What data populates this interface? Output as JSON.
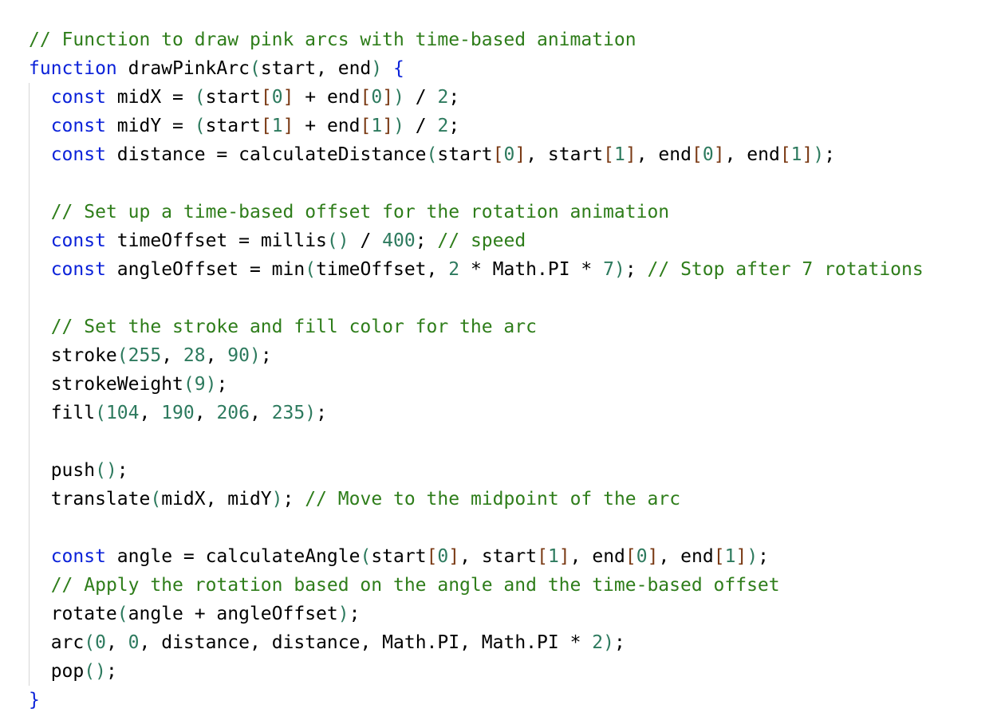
{
  "code": {
    "language": "javascript",
    "colors": {
      "keyword": "#0b22d9",
      "comment": "#2e7d1a",
      "number": "#2d7a5e",
      "square_bracket": "#7a3a14",
      "background": "#ffffff"
    },
    "lines": [
      {
        "tokens": [
          {
            "t": "// Function to draw pink arcs with time-based animation",
            "c": "cm"
          }
        ]
      },
      {
        "tokens": [
          {
            "t": "function",
            "c": "kw"
          },
          {
            "t": " drawPinkArc"
          },
          {
            "t": "(",
            "c": "pb"
          },
          {
            "t": "start, end"
          },
          {
            "t": ")",
            "c": "pb"
          },
          {
            "t": " "
          },
          {
            "t": "{",
            "c": "cb"
          }
        ]
      },
      {
        "tokens": [
          {
            "t": "  "
          },
          {
            "t": "const",
            "c": "kw"
          },
          {
            "t": " midX = "
          },
          {
            "t": "(",
            "c": "pb"
          },
          {
            "t": "start"
          },
          {
            "t": "[",
            "c": "br"
          },
          {
            "t": "0",
            "c": "num"
          },
          {
            "t": "]",
            "c": "br"
          },
          {
            "t": " + end"
          },
          {
            "t": "[",
            "c": "br"
          },
          {
            "t": "0",
            "c": "num"
          },
          {
            "t": "]",
            "c": "br"
          },
          {
            "t": ")",
            "c": "pb"
          },
          {
            "t": " / "
          },
          {
            "t": "2",
            "c": "num"
          },
          {
            "t": ";"
          }
        ]
      },
      {
        "tokens": [
          {
            "t": "  "
          },
          {
            "t": "const",
            "c": "kw"
          },
          {
            "t": " midY = "
          },
          {
            "t": "(",
            "c": "pb"
          },
          {
            "t": "start"
          },
          {
            "t": "[",
            "c": "br"
          },
          {
            "t": "1",
            "c": "num"
          },
          {
            "t": "]",
            "c": "br"
          },
          {
            "t": " + end"
          },
          {
            "t": "[",
            "c": "br"
          },
          {
            "t": "1",
            "c": "num"
          },
          {
            "t": "]",
            "c": "br"
          },
          {
            "t": ")",
            "c": "pb"
          },
          {
            "t": " / "
          },
          {
            "t": "2",
            "c": "num"
          },
          {
            "t": ";"
          }
        ]
      },
      {
        "tokens": [
          {
            "t": "  "
          },
          {
            "t": "const",
            "c": "kw"
          },
          {
            "t": " distance = calculateDistance"
          },
          {
            "t": "(",
            "c": "pb"
          },
          {
            "t": "start"
          },
          {
            "t": "[",
            "c": "br"
          },
          {
            "t": "0",
            "c": "num"
          },
          {
            "t": "]",
            "c": "br"
          },
          {
            "t": ", start"
          },
          {
            "t": "[",
            "c": "br"
          },
          {
            "t": "1",
            "c": "num"
          },
          {
            "t": "]",
            "c": "br"
          },
          {
            "t": ", end"
          },
          {
            "t": "[",
            "c": "br"
          },
          {
            "t": "0",
            "c": "num"
          },
          {
            "t": "]",
            "c": "br"
          },
          {
            "t": ", end"
          },
          {
            "t": "[",
            "c": "br"
          },
          {
            "t": "1",
            "c": "num"
          },
          {
            "t": "]",
            "c": "br"
          },
          {
            "t": ")",
            "c": "pb"
          },
          {
            "t": ";"
          }
        ]
      },
      {
        "tokens": []
      },
      {
        "tokens": [
          {
            "t": "  "
          },
          {
            "t": "// Set up a time-based offset for the rotation animation",
            "c": "cm"
          }
        ]
      },
      {
        "tokens": [
          {
            "t": "  "
          },
          {
            "t": "const",
            "c": "kw"
          },
          {
            "t": " timeOffset = millis"
          },
          {
            "t": "()",
            "c": "pb"
          },
          {
            "t": " / "
          },
          {
            "t": "400",
            "c": "num"
          },
          {
            "t": "; "
          },
          {
            "t": "// speed",
            "c": "cm"
          }
        ]
      },
      {
        "tokens": [
          {
            "t": "  "
          },
          {
            "t": "const",
            "c": "kw"
          },
          {
            "t": " angleOffset = min"
          },
          {
            "t": "(",
            "c": "pb"
          },
          {
            "t": "timeOffset, "
          },
          {
            "t": "2",
            "c": "num"
          },
          {
            "t": " * Math.PI * "
          },
          {
            "t": "7",
            "c": "num"
          },
          {
            "t": ")",
            "c": "pb"
          },
          {
            "t": "; "
          },
          {
            "t": "// Stop after 7 rotations",
            "c": "cm"
          }
        ]
      },
      {
        "tokens": []
      },
      {
        "tokens": [
          {
            "t": "  "
          },
          {
            "t": "// Set the stroke and fill color for the arc",
            "c": "cm"
          }
        ]
      },
      {
        "tokens": [
          {
            "t": "  stroke"
          },
          {
            "t": "(",
            "c": "pb"
          },
          {
            "t": "255",
            "c": "num"
          },
          {
            "t": ", "
          },
          {
            "t": "28",
            "c": "num"
          },
          {
            "t": ", "
          },
          {
            "t": "90",
            "c": "num"
          },
          {
            "t": ")",
            "c": "pb"
          },
          {
            "t": ";"
          }
        ]
      },
      {
        "tokens": [
          {
            "t": "  strokeWeight"
          },
          {
            "t": "(",
            "c": "pb"
          },
          {
            "t": "9",
            "c": "num"
          },
          {
            "t": ")",
            "c": "pb"
          },
          {
            "t": ";"
          }
        ]
      },
      {
        "tokens": [
          {
            "t": "  fill"
          },
          {
            "t": "(",
            "c": "pb"
          },
          {
            "t": "104",
            "c": "num"
          },
          {
            "t": ", "
          },
          {
            "t": "190",
            "c": "num"
          },
          {
            "t": ", "
          },
          {
            "t": "206",
            "c": "num"
          },
          {
            "t": ", "
          },
          {
            "t": "235",
            "c": "num"
          },
          {
            "t": ")",
            "c": "pb"
          },
          {
            "t": ";"
          }
        ]
      },
      {
        "tokens": []
      },
      {
        "tokens": [
          {
            "t": "  push"
          },
          {
            "t": "()",
            "c": "pb"
          },
          {
            "t": ";"
          }
        ]
      },
      {
        "tokens": [
          {
            "t": "  translate"
          },
          {
            "t": "(",
            "c": "pb"
          },
          {
            "t": "midX, midY"
          },
          {
            "t": ")",
            "c": "pb"
          },
          {
            "t": "; "
          },
          {
            "t": "// Move to the midpoint of the arc",
            "c": "cm"
          }
        ]
      },
      {
        "tokens": []
      },
      {
        "tokens": [
          {
            "t": "  "
          },
          {
            "t": "const",
            "c": "kw"
          },
          {
            "t": " angle = calculateAngle"
          },
          {
            "t": "(",
            "c": "pb"
          },
          {
            "t": "start"
          },
          {
            "t": "[",
            "c": "br"
          },
          {
            "t": "0",
            "c": "num"
          },
          {
            "t": "]",
            "c": "br"
          },
          {
            "t": ", start"
          },
          {
            "t": "[",
            "c": "br"
          },
          {
            "t": "1",
            "c": "num"
          },
          {
            "t": "]",
            "c": "br"
          },
          {
            "t": ", end"
          },
          {
            "t": "[",
            "c": "br"
          },
          {
            "t": "0",
            "c": "num"
          },
          {
            "t": "]",
            "c": "br"
          },
          {
            "t": ", end"
          },
          {
            "t": "[",
            "c": "br"
          },
          {
            "t": "1",
            "c": "num"
          },
          {
            "t": "]",
            "c": "br"
          },
          {
            "t": ")",
            "c": "pb"
          },
          {
            "t": ";"
          }
        ]
      },
      {
        "tokens": [
          {
            "t": "  "
          },
          {
            "t": "// Apply the rotation based on the angle and the time-based offset",
            "c": "cm"
          }
        ]
      },
      {
        "tokens": [
          {
            "t": "  rotate"
          },
          {
            "t": "(",
            "c": "pb"
          },
          {
            "t": "angle + angleOffset"
          },
          {
            "t": ")",
            "c": "pb"
          },
          {
            "t": ";"
          }
        ]
      },
      {
        "tokens": [
          {
            "t": "  arc"
          },
          {
            "t": "(",
            "c": "pb"
          },
          {
            "t": "0",
            "c": "num"
          },
          {
            "t": ", "
          },
          {
            "t": "0",
            "c": "num"
          },
          {
            "t": ", distance, distance, Math.PI, Math.PI * "
          },
          {
            "t": "2",
            "c": "num"
          },
          {
            "t": ")",
            "c": "pb"
          },
          {
            "t": ";"
          }
        ]
      },
      {
        "tokens": [
          {
            "t": "  pop"
          },
          {
            "t": "()",
            "c": "pb"
          },
          {
            "t": ";"
          }
        ]
      },
      {
        "tokens": [
          {
            "t": "}",
            "c": "cb"
          }
        ]
      }
    ]
  }
}
